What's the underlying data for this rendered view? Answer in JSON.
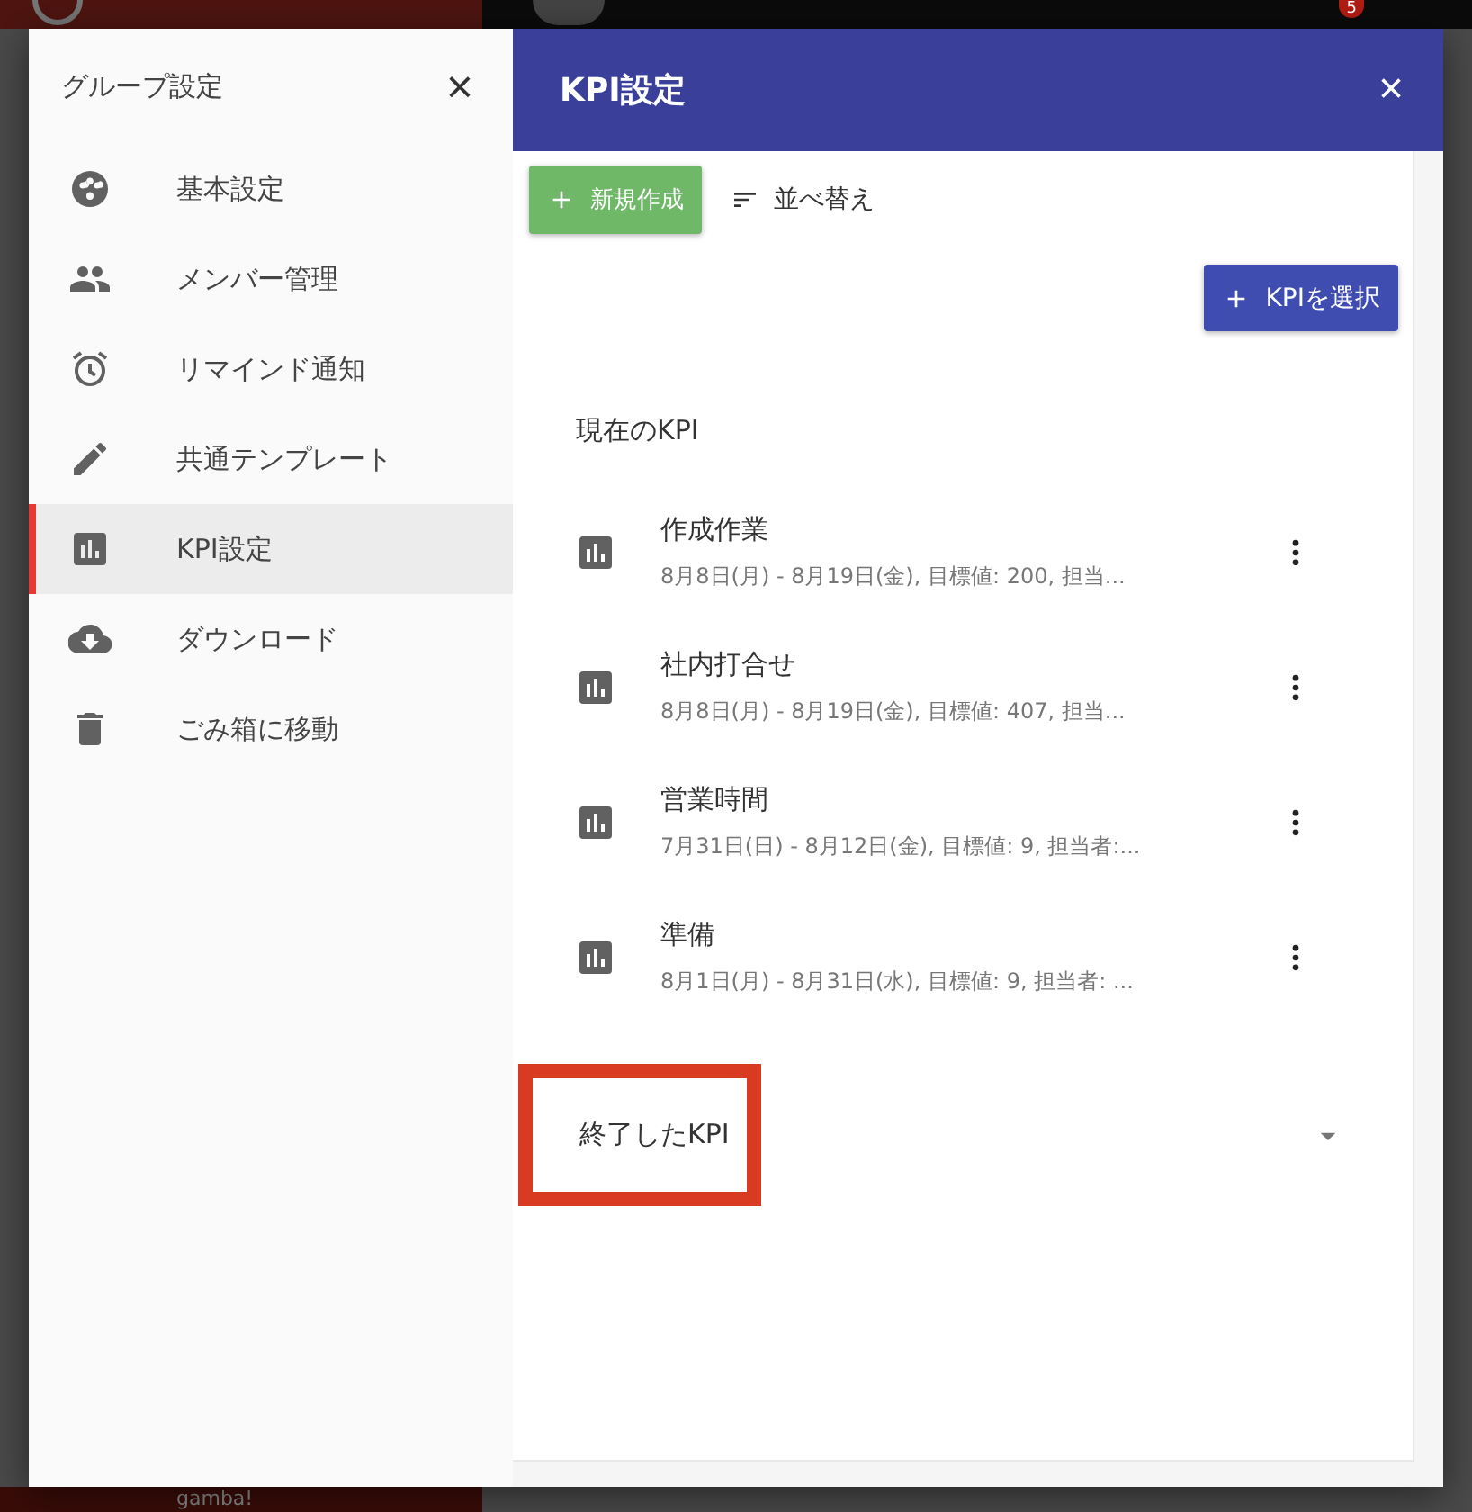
{
  "background_app": {
    "badge": "5",
    "logo": "gamba!"
  },
  "sidebar": {
    "title": "グループ設定",
    "close": "×",
    "items": [
      {
        "label": "基本設定",
        "selected": false
      },
      {
        "label": "メンバー管理",
        "selected": false
      },
      {
        "label": "リマインド通知",
        "selected": false
      },
      {
        "label": "共通テンプレート",
        "selected": false
      },
      {
        "label": "KPI設定",
        "selected": true
      },
      {
        "label": "ダウンロード",
        "selected": false
      },
      {
        "label": "ごみ箱に移動",
        "selected": false
      }
    ]
  },
  "panel": {
    "title": "KPI設定",
    "close": "×",
    "toolbar": {
      "create": "新規作成",
      "sort": "並べ替え"
    },
    "select_button": "KPIを選択",
    "current_heading": "現在のKPI",
    "kpis": [
      {
        "title": "作成作業",
        "detail": "8月8日(月) - 8月19日(金), 目標値: 200, 担当..."
      },
      {
        "title": "社内打合せ",
        "detail": "8月8日(月) - 8月19日(金), 目標値: 407, 担当..."
      },
      {
        "title": "営業時間",
        "detail": "7月31日(日) - 8月12日(金), 目標値: 9, 担当者:..."
      },
      {
        "title": "準備",
        "detail": "8月1日(月) - 8月31日(水), 目標値: 9, 担当者: ..."
      }
    ],
    "ended": {
      "label": "終了したKPI",
      "expanded": false,
      "highlighted": true
    }
  }
}
